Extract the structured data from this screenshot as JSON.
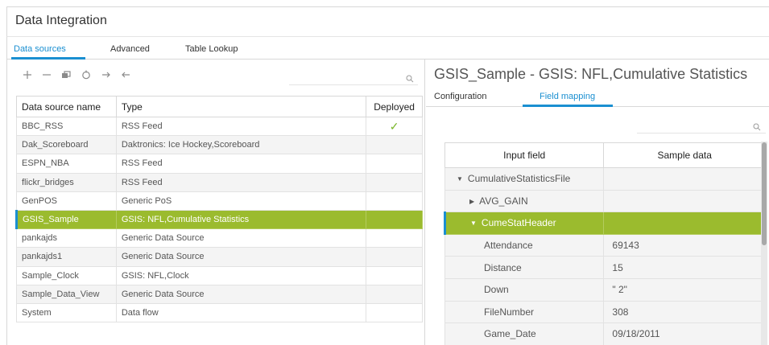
{
  "app": {
    "title": "Data Integration"
  },
  "tabs": [
    {
      "label": "Data sources",
      "active": true
    },
    {
      "label": "Advanced",
      "active": false
    },
    {
      "label": "Table Lookup",
      "active": false
    }
  ],
  "toolbar": {
    "icons": [
      "plus-icon",
      "minus-icon",
      "copy-icon",
      "refresh-icon",
      "import-icon",
      "export-icon"
    ],
    "search_placeholder": ""
  },
  "datasources": {
    "columns": [
      "Data source name",
      "Type",
      "Deployed"
    ],
    "rows": [
      {
        "name": "BBC_RSS",
        "type": "RSS Feed",
        "deployed": true
      },
      {
        "name": "Dak_Scoreboard",
        "type": "Daktronics: Ice Hockey,Scoreboard",
        "deployed": false
      },
      {
        "name": "ESPN_NBA",
        "type": "RSS Feed",
        "deployed": false
      },
      {
        "name": "flickr_bridges",
        "type": "RSS Feed",
        "deployed": false
      },
      {
        "name": "GenPOS",
        "type": "Generic PoS",
        "deployed": false
      },
      {
        "name": "GSIS_Sample",
        "type": "GSIS: NFL,Cumulative Statistics",
        "deployed": false
      },
      {
        "name": "pankajds",
        "type": "Generic Data Source",
        "deployed": false
      },
      {
        "name": "pankajds1",
        "type": "Generic Data Source",
        "deployed": false
      },
      {
        "name": "Sample_Clock",
        "type": "GSIS: NFL,Clock",
        "deployed": false
      },
      {
        "name": "Sample_Data_View",
        "type": "Generic Data Source",
        "deployed": false
      },
      {
        "name": "System",
        "type": "Data flow",
        "deployed": false
      }
    ],
    "selected_index": 5
  },
  "detail": {
    "title": "GSIS_Sample - GSIS: NFL,Cumulative Statistics",
    "tabs": [
      {
        "label": "Configuration",
        "active": false
      },
      {
        "label": "Field mapping",
        "active": true
      }
    ],
    "search_placeholder": "",
    "mapping": {
      "columns": [
        "Input field",
        "Sample data"
      ],
      "rows": [
        {
          "field": "CumulativeStatisticsFile",
          "value": "",
          "toggle": "expanded",
          "level": 0
        },
        {
          "field": "AVG_GAIN",
          "value": "",
          "toggle": "collapsed",
          "level": 1
        },
        {
          "field": "CumeStatHeader",
          "value": "",
          "toggle": "expanded",
          "level": 1,
          "selected": true
        },
        {
          "field": "Attendance",
          "value": "69143",
          "toggle": "",
          "level": 2
        },
        {
          "field": "Distance",
          "value": "15",
          "toggle": "",
          "level": 2
        },
        {
          "field": "Down",
          "value": "\" 2\"",
          "toggle": "",
          "level": 2
        },
        {
          "field": "FileNumber",
          "value": "308",
          "toggle": "",
          "level": 2
        },
        {
          "field": "Game_Date",
          "value": "09/18/2011",
          "toggle": "",
          "level": 2
        }
      ]
    }
  },
  "colors": {
    "accent": "#1a8fd1",
    "selection": "#9bbb2e",
    "check": "#7ab62a"
  }
}
